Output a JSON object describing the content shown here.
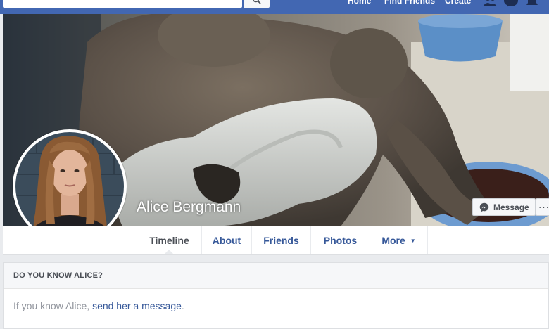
{
  "topnav": {
    "home": "Home",
    "find_friends": "Find Friends",
    "create": "Create",
    "icons": [
      "friend-requests-icon",
      "messenger-icon",
      "notifications-icon"
    ]
  },
  "profile": {
    "name": "Alice Bergmann",
    "message_button": "Message",
    "more_options": "···"
  },
  "tabs": [
    {
      "label": "Timeline",
      "active": true
    },
    {
      "label": "About"
    },
    {
      "label": "Friends"
    },
    {
      "label": "Photos"
    },
    {
      "label": "More",
      "dropdown": true
    }
  ],
  "know_card": {
    "header": "DO YOU KNOW ALICE?",
    "prefix": "If you know Alice, ",
    "link": "send her a message",
    "suffix": "."
  },
  "colors": {
    "brand_blue": "#4267b2",
    "link_blue": "#365899",
    "page_bg": "#e9ebee"
  }
}
